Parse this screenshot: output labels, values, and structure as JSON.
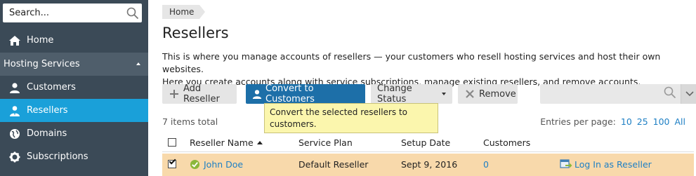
{
  "sidebar": {
    "search_placeholder": "Search...",
    "home_label": "Home",
    "section_label": "Hosting Services",
    "items": [
      {
        "label": "Customers"
      },
      {
        "label": "Resellers"
      },
      {
        "label": "Domains"
      },
      {
        "label": "Subscriptions"
      }
    ]
  },
  "breadcrumb": {
    "home": "Home"
  },
  "page": {
    "title": "Resellers",
    "description_line1": "This is where you manage accounts of resellers — your customers who resell hosting services and host their own websites.",
    "description_line2": "Here you create accounts along with service subscriptions, manage existing resellers, and remove accounts."
  },
  "toolbar": {
    "add_reseller": "Add Reseller",
    "convert": "Convert to Customers",
    "change_status": "Change Status",
    "remove": "Remove"
  },
  "tooltip": {
    "line1": "Convert the selected resellers to",
    "line2": "customers."
  },
  "list": {
    "items_total": "7 items total",
    "entries_label": "Entries per page:",
    "entries_options": [
      "10",
      "25",
      "100",
      "All"
    ],
    "columns": [
      "Reseller Name",
      "Service Plan",
      "Setup Date",
      "Customers"
    ],
    "rows": [
      {
        "name": "John Doe",
        "plan": "Default Reseller",
        "setup_date": "Sept 9, 2016",
        "customers": "0",
        "action": "Log In as Reseller",
        "selected": true
      }
    ]
  },
  "colors": {
    "sidebar_bg": "#3b4a57",
    "active_item": "#1aa0d9",
    "primary_button": "#1d6fa8",
    "selected_row": "#f8d9ab",
    "tooltip_bg": "#fbf6ad",
    "link": "#1d7fc4"
  }
}
